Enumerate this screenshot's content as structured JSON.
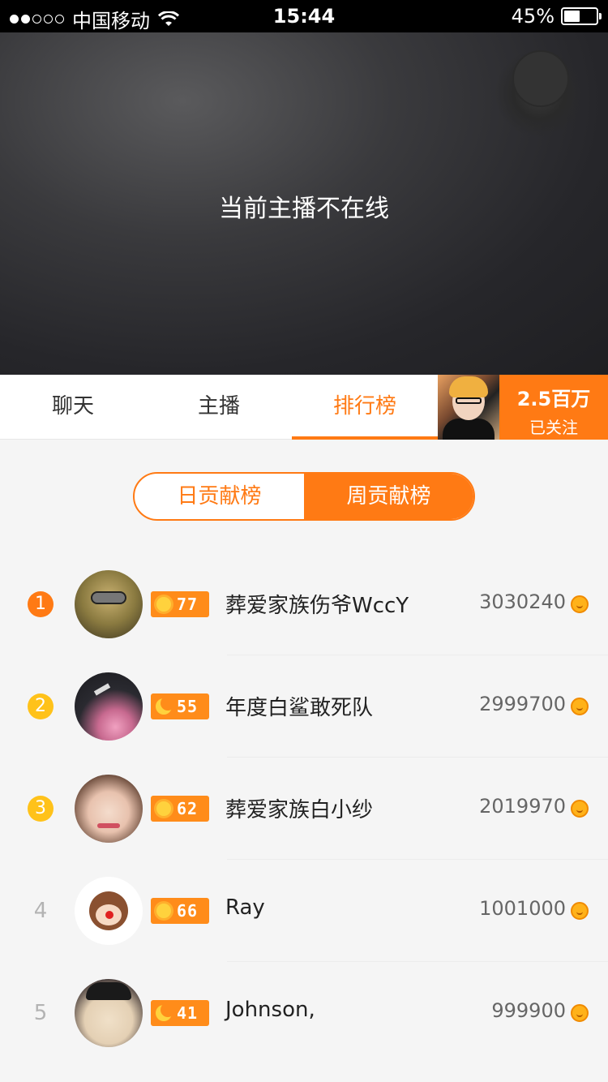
{
  "status_bar": {
    "carrier": "中国移动",
    "time": "15:44",
    "battery": "45%",
    "battery_level": 0.45
  },
  "video": {
    "offline_text": "当前主播不在线"
  },
  "tabs": [
    {
      "label": "聊天"
    },
    {
      "label": "主播"
    },
    {
      "label": "排行榜"
    }
  ],
  "anchor": {
    "followers": "2.5百万",
    "follow_status": "已关注"
  },
  "ranking_toggle": {
    "daily": "日贡献榜",
    "weekly": "周贡献榜"
  },
  "colors": {
    "accent": "#ff7a14",
    "rank1": "#ff7a14",
    "rank2": "#ffc21a",
    "rank3": "#ffc21a"
  },
  "ranking": [
    {
      "rank": "1",
      "level": "77",
      "level_icon": "sun-icon",
      "name": "葬爱家族伤爷WccY",
      "score": "3030240"
    },
    {
      "rank": "2",
      "level": "55",
      "level_icon": "moon-icon",
      "name": "年度白鲨敢死队",
      "score": "2999700"
    },
    {
      "rank": "3",
      "level": "62",
      "level_icon": "sun-icon",
      "name": "葬爱家族白小纱",
      "score": "2019970"
    },
    {
      "rank": "4",
      "level": "66",
      "level_icon": "sun-icon",
      "name": "Ray",
      "score": "1001000"
    },
    {
      "rank": "5",
      "level": "41",
      "level_icon": "moon-icon",
      "name": "Johnson,",
      "score": "999900"
    }
  ]
}
